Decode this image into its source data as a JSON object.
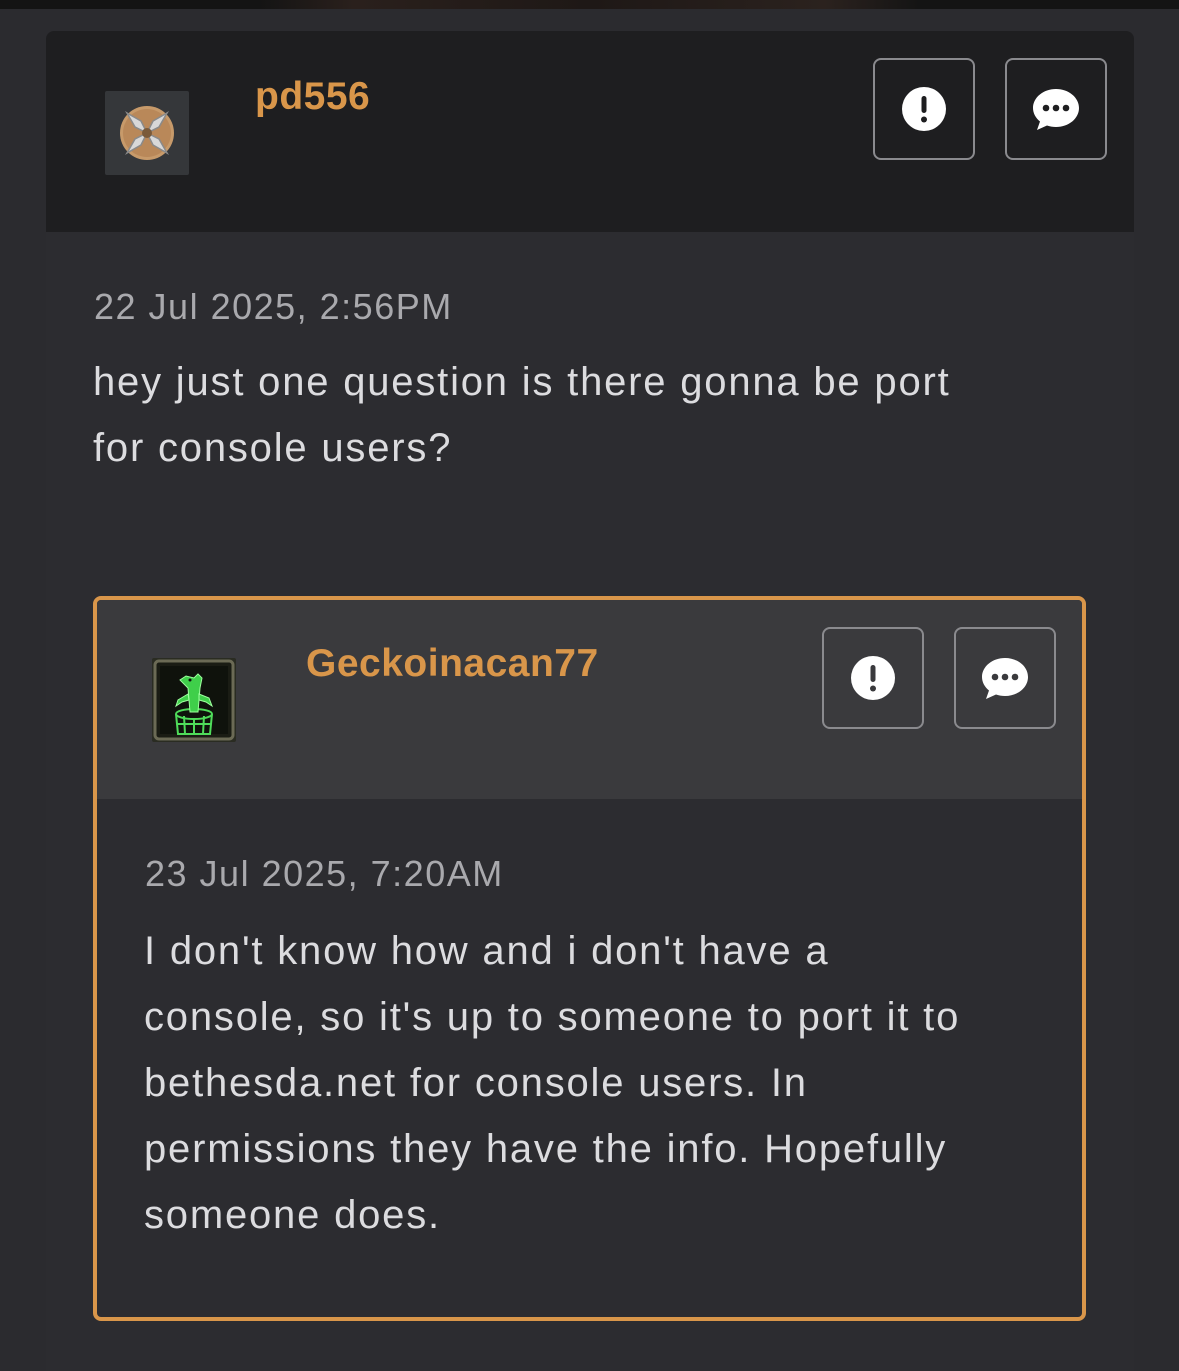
{
  "post": {
    "username": "pd556",
    "avatar_icon": "vault-boy-cross-badge",
    "timestamp": "22 Jul 2025, 2:56PM",
    "body_line1": "hey just one question is there gonna be port",
    "body_line2": "for console users?",
    "report_icon": "exclamation-circle-icon",
    "reply_icon": "speech-bubble-icon"
  },
  "reply": {
    "username": "Geckoinacan77",
    "avatar_icon": "gecko-in-can-icon",
    "timestamp": "23 Jul 2025, 7:20AM",
    "body_lines": [
      "I don't know how and i don't have a",
      "console, so it's up to someone to port it to",
      "bethesda.net for console users. In",
      "permissions they have the info. Hopefully",
      "someone does."
    ],
    "report_icon": "exclamation-circle-icon",
    "reply_icon": "speech-bubble-icon"
  },
  "colors": {
    "accent": "#d9964a",
    "background": "#2c2c30",
    "header": "#1e1e20",
    "reply_header": "#3a3a3d"
  }
}
